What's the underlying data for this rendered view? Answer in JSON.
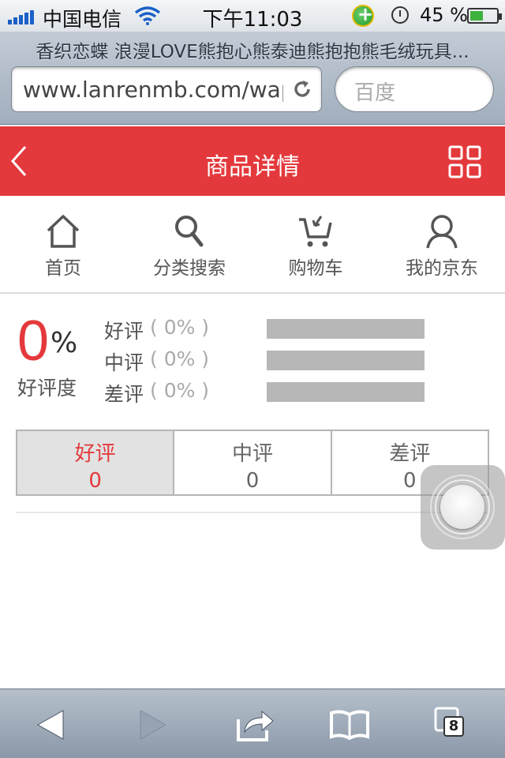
{
  "status_bar": {
    "carrier": "中国电信",
    "time": "下午11:03",
    "battery_percent": "45 %",
    "battery_level": 0.45
  },
  "browser": {
    "page_title": "香织恋蝶 浪漫LOVE熊抱心熊泰迪熊抱抱熊毛绒玩具...",
    "url": "www.lanrenmb.com/wap",
    "search_placeholder": "百度",
    "tab_count": "8"
  },
  "header": {
    "title": "商品详情"
  },
  "nav": {
    "items": [
      {
        "label": "首页",
        "icon": "home-icon"
      },
      {
        "label": "分类搜索",
        "icon": "search-icon"
      },
      {
        "label": "购物车",
        "icon": "cart-icon"
      },
      {
        "label": "我的京东",
        "icon": "user-icon"
      }
    ]
  },
  "rating": {
    "score": "0",
    "percent_sign": "%",
    "caption": "好评度",
    "rows": [
      {
        "label": "好评",
        "value": "( 0% )",
        "fraction": 0
      },
      {
        "label": "中评",
        "value": "( 0% )",
        "fraction": 0
      },
      {
        "label": "差评",
        "value": "( 0% )",
        "fraction": 0
      }
    ]
  },
  "tabs": [
    {
      "label": "好评",
      "count": "0",
      "active": true
    },
    {
      "label": "中评",
      "count": "0",
      "active": false
    },
    {
      "label": "差评",
      "count": "0",
      "active": false
    }
  ],
  "colors": {
    "accent": "#e4393c",
    "bar_empty": "#b7b7b7"
  }
}
